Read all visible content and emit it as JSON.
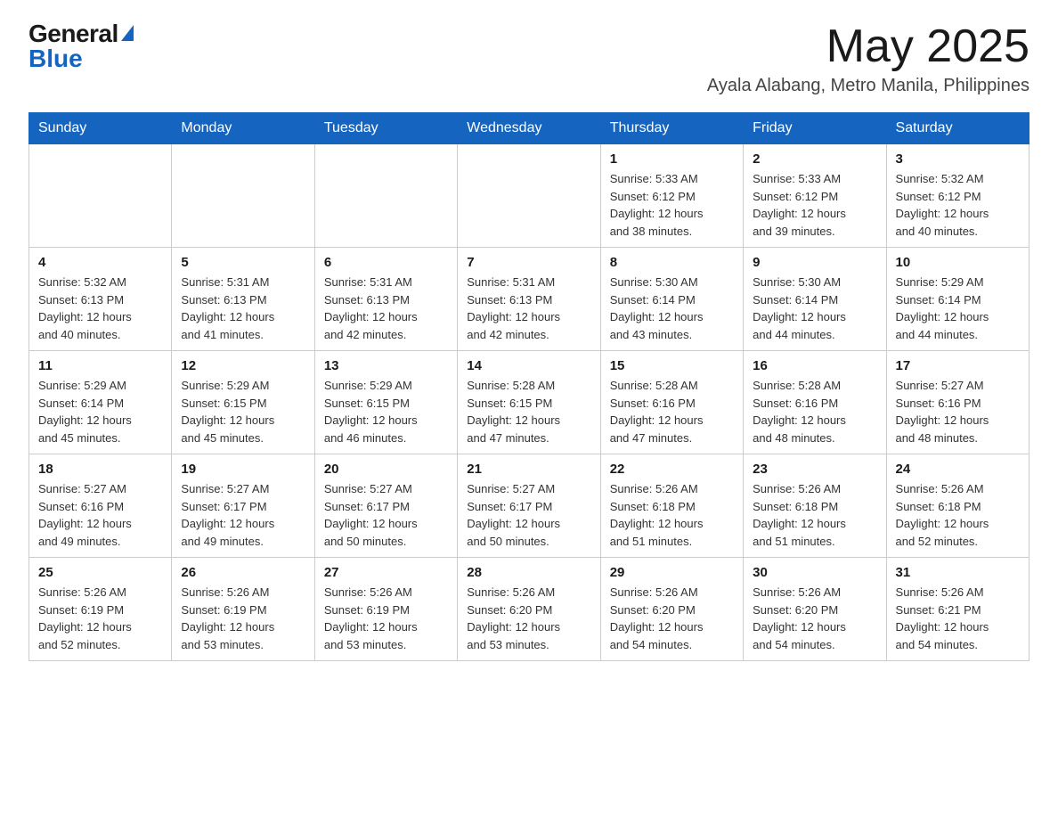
{
  "logo": {
    "general": "General",
    "blue": "Blue"
  },
  "title": {
    "month_year": "May 2025",
    "location": "Ayala Alabang, Metro Manila, Philippines"
  },
  "days_of_week": [
    "Sunday",
    "Monday",
    "Tuesday",
    "Wednesday",
    "Thursday",
    "Friday",
    "Saturday"
  ],
  "weeks": [
    [
      {
        "day": "",
        "info": ""
      },
      {
        "day": "",
        "info": ""
      },
      {
        "day": "",
        "info": ""
      },
      {
        "day": "",
        "info": ""
      },
      {
        "day": "1",
        "info": "Sunrise: 5:33 AM\nSunset: 6:12 PM\nDaylight: 12 hours\nand 38 minutes."
      },
      {
        "day": "2",
        "info": "Sunrise: 5:33 AM\nSunset: 6:12 PM\nDaylight: 12 hours\nand 39 minutes."
      },
      {
        "day": "3",
        "info": "Sunrise: 5:32 AM\nSunset: 6:12 PM\nDaylight: 12 hours\nand 40 minutes."
      }
    ],
    [
      {
        "day": "4",
        "info": "Sunrise: 5:32 AM\nSunset: 6:13 PM\nDaylight: 12 hours\nand 40 minutes."
      },
      {
        "day": "5",
        "info": "Sunrise: 5:31 AM\nSunset: 6:13 PM\nDaylight: 12 hours\nand 41 minutes."
      },
      {
        "day": "6",
        "info": "Sunrise: 5:31 AM\nSunset: 6:13 PM\nDaylight: 12 hours\nand 42 minutes."
      },
      {
        "day": "7",
        "info": "Sunrise: 5:31 AM\nSunset: 6:13 PM\nDaylight: 12 hours\nand 42 minutes."
      },
      {
        "day": "8",
        "info": "Sunrise: 5:30 AM\nSunset: 6:14 PM\nDaylight: 12 hours\nand 43 minutes."
      },
      {
        "day": "9",
        "info": "Sunrise: 5:30 AM\nSunset: 6:14 PM\nDaylight: 12 hours\nand 44 minutes."
      },
      {
        "day": "10",
        "info": "Sunrise: 5:29 AM\nSunset: 6:14 PM\nDaylight: 12 hours\nand 44 minutes."
      }
    ],
    [
      {
        "day": "11",
        "info": "Sunrise: 5:29 AM\nSunset: 6:14 PM\nDaylight: 12 hours\nand 45 minutes."
      },
      {
        "day": "12",
        "info": "Sunrise: 5:29 AM\nSunset: 6:15 PM\nDaylight: 12 hours\nand 45 minutes."
      },
      {
        "day": "13",
        "info": "Sunrise: 5:29 AM\nSunset: 6:15 PM\nDaylight: 12 hours\nand 46 minutes."
      },
      {
        "day": "14",
        "info": "Sunrise: 5:28 AM\nSunset: 6:15 PM\nDaylight: 12 hours\nand 47 minutes."
      },
      {
        "day": "15",
        "info": "Sunrise: 5:28 AM\nSunset: 6:16 PM\nDaylight: 12 hours\nand 47 minutes."
      },
      {
        "day": "16",
        "info": "Sunrise: 5:28 AM\nSunset: 6:16 PM\nDaylight: 12 hours\nand 48 minutes."
      },
      {
        "day": "17",
        "info": "Sunrise: 5:27 AM\nSunset: 6:16 PM\nDaylight: 12 hours\nand 48 minutes."
      }
    ],
    [
      {
        "day": "18",
        "info": "Sunrise: 5:27 AM\nSunset: 6:16 PM\nDaylight: 12 hours\nand 49 minutes."
      },
      {
        "day": "19",
        "info": "Sunrise: 5:27 AM\nSunset: 6:17 PM\nDaylight: 12 hours\nand 49 minutes."
      },
      {
        "day": "20",
        "info": "Sunrise: 5:27 AM\nSunset: 6:17 PM\nDaylight: 12 hours\nand 50 minutes."
      },
      {
        "day": "21",
        "info": "Sunrise: 5:27 AM\nSunset: 6:17 PM\nDaylight: 12 hours\nand 50 minutes."
      },
      {
        "day": "22",
        "info": "Sunrise: 5:26 AM\nSunset: 6:18 PM\nDaylight: 12 hours\nand 51 minutes."
      },
      {
        "day": "23",
        "info": "Sunrise: 5:26 AM\nSunset: 6:18 PM\nDaylight: 12 hours\nand 51 minutes."
      },
      {
        "day": "24",
        "info": "Sunrise: 5:26 AM\nSunset: 6:18 PM\nDaylight: 12 hours\nand 52 minutes."
      }
    ],
    [
      {
        "day": "25",
        "info": "Sunrise: 5:26 AM\nSunset: 6:19 PM\nDaylight: 12 hours\nand 52 minutes."
      },
      {
        "day": "26",
        "info": "Sunrise: 5:26 AM\nSunset: 6:19 PM\nDaylight: 12 hours\nand 53 minutes."
      },
      {
        "day": "27",
        "info": "Sunrise: 5:26 AM\nSunset: 6:19 PM\nDaylight: 12 hours\nand 53 minutes."
      },
      {
        "day": "28",
        "info": "Sunrise: 5:26 AM\nSunset: 6:20 PM\nDaylight: 12 hours\nand 53 minutes."
      },
      {
        "day": "29",
        "info": "Sunrise: 5:26 AM\nSunset: 6:20 PM\nDaylight: 12 hours\nand 54 minutes."
      },
      {
        "day": "30",
        "info": "Sunrise: 5:26 AM\nSunset: 6:20 PM\nDaylight: 12 hours\nand 54 minutes."
      },
      {
        "day": "31",
        "info": "Sunrise: 5:26 AM\nSunset: 6:21 PM\nDaylight: 12 hours\nand 54 minutes."
      }
    ]
  ]
}
